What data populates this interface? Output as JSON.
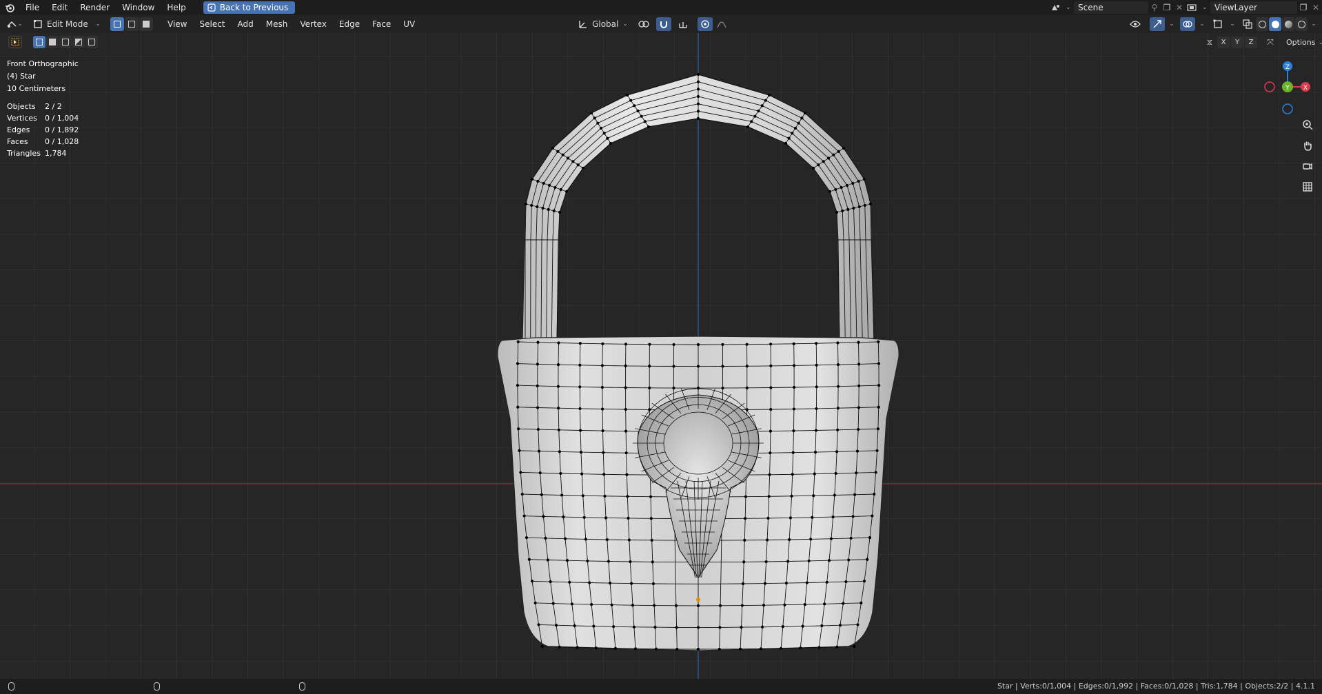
{
  "topbar": {
    "menus": [
      "File",
      "Edit",
      "Render",
      "Window",
      "Help"
    ],
    "back_label": "Back to Previous",
    "scene_label": "Scene",
    "viewlayer_label": "ViewLayer"
  },
  "header": {
    "mode_label": "Edit Mode",
    "menus": [
      "View",
      "Select",
      "Add",
      "Mesh",
      "Vertex",
      "Edge",
      "Face",
      "UV"
    ],
    "transform_orientation": "Global",
    "options_label": "Options",
    "axis_x": "X",
    "axis_y": "Y",
    "axis_z": "Z"
  },
  "overlay": {
    "view_name": "Front Orthographic",
    "object_name": "(4) Star",
    "scale": "10 Centimeters",
    "stats": [
      {
        "label": "Objects",
        "value": "2 / 2"
      },
      {
        "label": "Vertices",
        "value": "0 / 1,004"
      },
      {
        "label": "Edges",
        "value": "0 / 1,892"
      },
      {
        "label": "Faces",
        "value": "0 / 1,028"
      },
      {
        "label": "Triangles",
        "value": "1,784"
      }
    ]
  },
  "gizmo": {
    "x": "X",
    "y": "Y",
    "z": "Z"
  },
  "status": {
    "text": "Star | Verts:0/1,004 | Edges:0/1,992 | Faces:0/1,028 | Tris:1,784 | Objects:2/2 | 4.1.1"
  },
  "colors": {
    "accent": "#4772b3",
    "x_axis": "#e2384b",
    "y_axis": "#6ab52a",
    "z_axis": "#2f7fd6"
  }
}
